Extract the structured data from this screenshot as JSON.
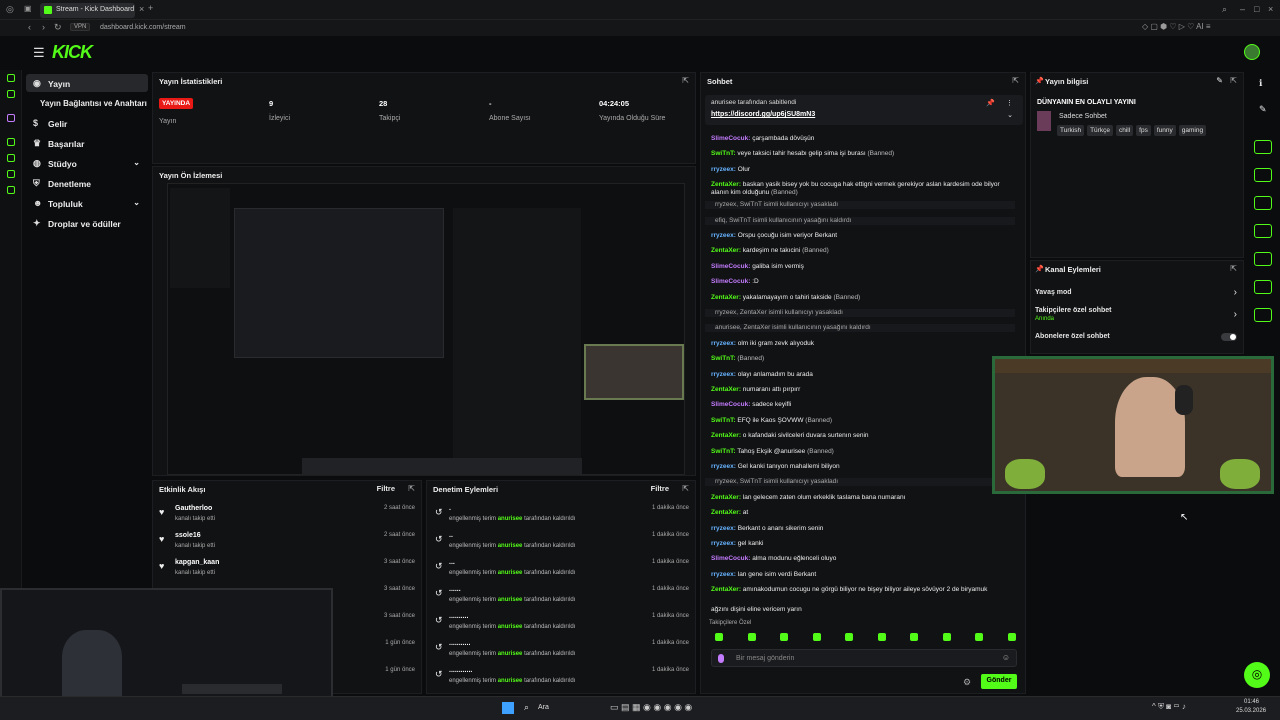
{
  "browser": {
    "tab_title": "Stream - Kick Dashboard",
    "vpn_label": "VPN",
    "url": "dashboard.kick.com/stream"
  },
  "app": {
    "logo": "KICK"
  },
  "sidebar": {
    "items": [
      {
        "label": "Yayın",
        "icon": "broadcast-icon"
      },
      {
        "label": "Yayın Bağlantısı ve Anahtarı",
        "icon": ""
      },
      {
        "label": "Gelir",
        "icon": "dollar-icon"
      },
      {
        "label": "Başarılar",
        "icon": "trophy-icon"
      },
      {
        "label": "Stüdyo",
        "icon": "studio-icon"
      },
      {
        "label": "Denetleme",
        "icon": "shield-icon"
      },
      {
        "label": "Topluluk",
        "icon": "community-icon"
      },
      {
        "label": "Droplar ve ödüller",
        "icon": "gift-icon"
      }
    ]
  },
  "stats": {
    "title": "Yayın İstatistikleri",
    "live_badge": "YAYINDA",
    "items": [
      {
        "value": "",
        "label": "Yayın"
      },
      {
        "value": "9",
        "label": "İzleyici"
      },
      {
        "value": "28",
        "label": "Takipçi"
      },
      {
        "value": "-",
        "label": "Abone Sayısı"
      },
      {
        "value": "04:24:05",
        "label": "Yayında Olduğu Süre"
      }
    ]
  },
  "preview": {
    "title": "Yayın Ön İzlemesi"
  },
  "activity": {
    "title": "Etkinlik Akışı",
    "filter": "Filtre",
    "rows": [
      {
        "name": "Gautherloo",
        "sub": "kanalı takip etti",
        "time": "2 saat önce"
      },
      {
        "name": "ssole16",
        "sub": "kanalı takip etti",
        "time": "2 saat önce"
      },
      {
        "name": "kapgan_kaan",
        "sub": "kanalı takip etti",
        "time": "3 saat önce"
      },
      {
        "name": "",
        "sub": "",
        "time": "3 saat önce"
      },
      {
        "name": "",
        "sub": "",
        "time": "3 saat önce"
      },
      {
        "name": "",
        "sub": "",
        "time": "1 gün önce"
      },
      {
        "name": "",
        "sub": "",
        "time": "1 gün önce"
      }
    ]
  },
  "moderation": {
    "title": "Denetim Eylemleri",
    "filter": "Filtre",
    "rows": [
      {
        "name": ".",
        "pre": "engellenmiş terim",
        "user": "anurisee",
        "post": "tarafından kaldırıldı",
        "time": "1 dakika önce"
      },
      {
        "name": "..",
        "pre": "engellenmiş terim",
        "user": "anurisee",
        "post": "tarafından kaldırıldı",
        "time": "1 dakika önce"
      },
      {
        "name": "...",
        "pre": "engellenmiş terim",
        "user": "anurisee",
        "post": "tarafından kaldırıldı",
        "time": "1 dakika önce"
      },
      {
        "name": "......",
        "pre": "engellenmiş terim",
        "user": "anurisee",
        "post": "tarafından kaldırıldı",
        "time": "1 dakika önce"
      },
      {
        "name": "..........",
        "pre": "engellenmiş terim",
        "user": "anurisee",
        "post": "tarafından kaldırıldı",
        "time": "1 dakika önce"
      },
      {
        "name": "...........",
        "pre": "engellenmiş terim",
        "user": "anurisee",
        "post": "tarafından kaldırıldı",
        "time": "1 dakika önce"
      },
      {
        "name": "............",
        "pre": "engellenmiş terim",
        "user": "anurisee",
        "post": "tarafından kaldırıldı",
        "time": "1 dakika önce"
      }
    ]
  },
  "chat": {
    "title": "Sohbet",
    "pinned_by": "anurisee tarafından sabitlendi",
    "pinned_link": "https://discord.gg/up6jSU8mN3",
    "followers_only": "Takipçilere Özel",
    "input_placeholder": "Bir mesaj gönderin",
    "send": "Gönder",
    "messages": [
      {
        "user": "SlimeCocuk:",
        "color": "p",
        "text": "çarşambada dövüşün",
        "ban": ""
      },
      {
        "user": "SwiTnT:",
        "color": "g",
        "text": "veye taksici tahir hesabı gelip sima işi burası",
        "ban": "(Banned)"
      },
      {
        "user": "rryzeex:",
        "color": "b",
        "text": "Olur",
        "ban": ""
      },
      {
        "user": "ZentaXer:",
        "color": "g",
        "text": "baskan yasik bisey yok bu cocuga hak ettigni vermek gerekiyor aslan kardesim ode bilyor alanın kim olduğunu",
        "ban": "(Banned)"
      },
      {
        "sys": "rryzeex, SwiTnT isimli kullanıcıyı yasakladı"
      },
      {
        "sys": "efiq, SwiTnT isimli kullanıcının yasağını kaldırdı"
      },
      {
        "user": "rryzeex:",
        "color": "b",
        "text": "Orspu çocuğu isim veriyor Berkant",
        "ban": ""
      },
      {
        "user": "ZentaXer:",
        "color": "g",
        "text": "kardeşim ne takıcini",
        "ban": "(Banned)"
      },
      {
        "user": "SlimeCocuk:",
        "color": "p",
        "text": "galiba isim vermiş",
        "ban": ""
      },
      {
        "user": "SlimeCocuk:",
        "color": "p",
        "text": ":D",
        "ban": ""
      },
      {
        "user": "ZentaXer:",
        "color": "g",
        "text": "yakalamayayım o tahiri takside",
        "ban": "(Banned)"
      },
      {
        "sys": "rryzeex, ZentaXer isimli kullanıcıyı yasakladı"
      },
      {
        "sys": "anurisee, ZentaXer isimli kullanıcının yasağını kaldırdı"
      },
      {
        "user": "rryzeex:",
        "color": "b",
        "text": "olm iki gram zevk alıyoduk",
        "ban": ""
      },
      {
        "user": "SwiTnT:",
        "color": "g",
        "text": "",
        "ban": "(Banned)"
      },
      {
        "user": "rryzeex:",
        "color": "b",
        "text": "olayı anlamadım bu arada",
        "ban": ""
      },
      {
        "user": "ZentaXer:",
        "color": "g",
        "text": "numaranı attı pırpırr",
        "ban": ""
      },
      {
        "user": "SlimeCocuk:",
        "color": "p",
        "text": "sadece keyifli",
        "ban": ""
      },
      {
        "user": "SwiTnT:",
        "color": "g",
        "text": "EFQ ile Kaos ŞOVWW",
        "ban": "(Banned)"
      },
      {
        "user": "ZentaXer:",
        "color": "g",
        "text": "o kafandaki sivilceleri duvara surtenın senin",
        "ban": ""
      },
      {
        "user": "SwiTnT:",
        "color": "g",
        "text": "Tahoş Ekşik @anurisee",
        "ban": "(Banned)"
      },
      {
        "user": "rryzeex:",
        "color": "b",
        "text": "Gel kanki tanıyon mahallemi biliyon",
        "ban": ""
      },
      {
        "sys": "rryzeex, SwiTnT isimli kullanıcıyı yasakladı"
      },
      {
        "user": "ZentaXer:",
        "color": "g",
        "text": "lan gelecem zaten olum erkeklik taslama bana numaranı",
        "ban": ""
      },
      {
        "user": "ZentaXer:",
        "color": "g",
        "text": "at",
        "ban": ""
      },
      {
        "user": "rryzeex:",
        "color": "b",
        "text": "Berkant o ananı sikerim senin",
        "ban": ""
      },
      {
        "user": "rryzeex:",
        "color": "b",
        "text": "gel kanki",
        "ban": ""
      },
      {
        "user": "SlimeCocuk:",
        "color": "p",
        "text": "alma modunu eğlenceli oluyo",
        "ban": ""
      },
      {
        "user": "rryzeex:",
        "color": "b",
        "text": "lan gene isim verdi Berkant",
        "ban": ""
      },
      {
        "user": "ZentaXer:",
        "color": "g",
        "text": "amınakodumun cocugu ne görgü biliyor ne bişey biliyor aileye sövüyor 2 de biryamuk",
        "ban": ""
      },
      {
        "user": "",
        "color": "g",
        "text": "ağzını dişini eline vericem yarın",
        "ban": ""
      }
    ]
  },
  "stream_info": {
    "title": "Yayın bilgisi",
    "stream_title": "DÜNYANIN EN OLAYLI YAYINI",
    "category": "Sadece Sohbet",
    "tags": [
      "Turkish",
      "Türkçe",
      "chill",
      "fps",
      "funny",
      "gaming"
    ]
  },
  "channel_actions": {
    "title": "Kanal Eylemleri",
    "items": [
      {
        "label": "Yavaş mod",
        "sub": ""
      },
      {
        "label": "Takipçilere özel sohbet",
        "sub": "Anında"
      },
      {
        "label": "Abonelere özel sohbet",
        "sub": ""
      }
    ]
  },
  "taskbar": {
    "search": "Ara",
    "time": "01:46",
    "date": "25.03.2026"
  }
}
